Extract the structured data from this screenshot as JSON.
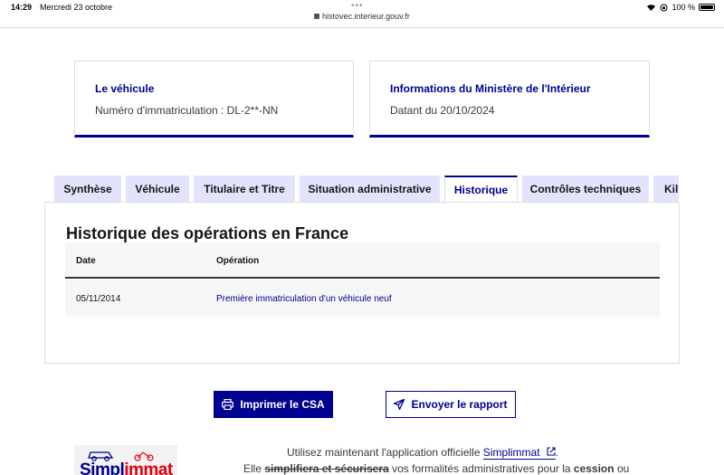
{
  "status_bar": {
    "time": "14:29",
    "date": "Mercredi 23 octobre",
    "battery": "100 %"
  },
  "browser": {
    "url": "histovec.interieur.gouv.fr"
  },
  "cards": {
    "vehicle": {
      "title": "Le véhicule",
      "text": "Numéro d'immatriculation : DL-2**-NN"
    },
    "info": {
      "title": "Informations du Ministère de l'Intérieur",
      "text": "Datant du 20/10/2024"
    }
  },
  "tabs": [
    {
      "label": "Synthèse"
    },
    {
      "label": "Véhicule"
    },
    {
      "label": "Titulaire et Titre"
    },
    {
      "label": "Situation administrative"
    },
    {
      "label": "Historique"
    },
    {
      "label": "Contrôles techniques"
    },
    {
      "label": "Kilo"
    }
  ],
  "history": {
    "title": "Historique des opérations en France",
    "columns": [
      "Date",
      "Opération"
    ],
    "rows": [
      {
        "date": "05/11/2014",
        "operation": "Première immatriculation d'un véhicule neuf"
      }
    ]
  },
  "actions": {
    "print": "Imprimer le CSA",
    "send": "Envoyer le rapport"
  },
  "promo": {
    "line1_prefix": "Utilisez maintenant l'application officielle",
    "link": "Simplimmat",
    "line1_suffix": ".",
    "line2_a": "Elle",
    "line2_strike": "simplifiera et sécurisera",
    "line2_b": "vos formalités administratives pour la",
    "line2_bold": "cession",
    "line2_c": "ou",
    "logo_a": "Simpl",
    "logo_b": "immat"
  },
  "colors": {
    "primary": "#000091",
    "tab_bg": "#e3e3fd",
    "accent_red": "#e1000f"
  }
}
